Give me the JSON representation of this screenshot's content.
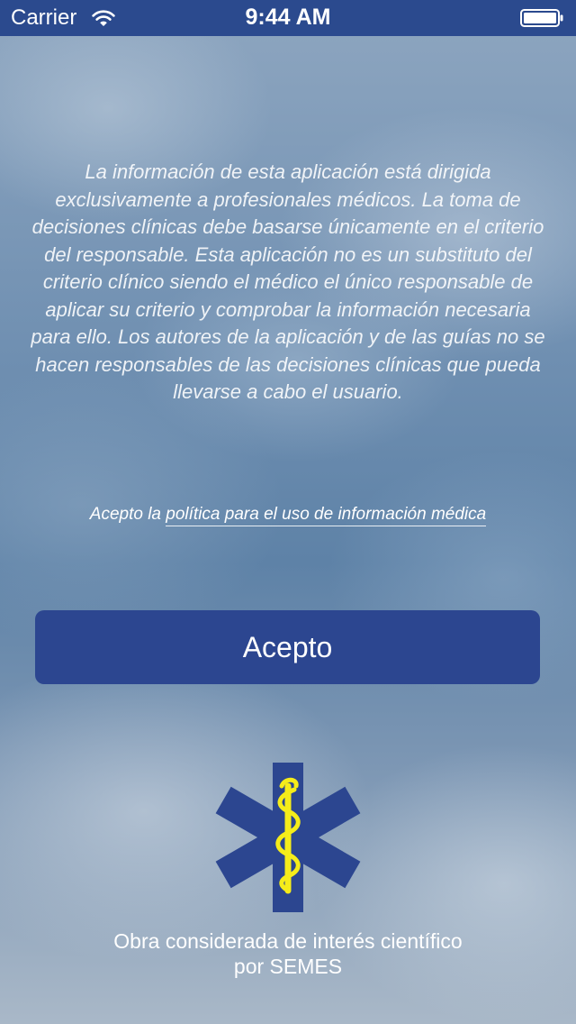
{
  "status_bar": {
    "carrier": "Carrier",
    "time": "9:44 AM",
    "wifi_icon": "wifi-icon",
    "battery_icon": "battery-icon"
  },
  "disclaimer": {
    "text": "La información de esta aplicación está dirigida exclusivamente a profesionales médicos. La toma de decisiones clínicas debe basarse únicamente en el criterio del responsable. Esta aplicación no es un substituto del criterio clínico siendo el médico el único responsable de aplicar su criterio y comprobar la información necesaria para ello. Los autores de la aplicación y de las guías no se hacen responsables de las decisiones clínicas que pueda llevarse a cabo el usuario."
  },
  "policy": {
    "prefix": "Acepto la ",
    "link_text": "política para el uso de información médica"
  },
  "accept_button": {
    "label": "Acepto"
  },
  "logo": {
    "icon": "star-of-life-icon",
    "colors": {
      "star": "#2c4690",
      "staff": "#f5ec1a"
    }
  },
  "footer": {
    "line1": "Obra considerada de interés científico",
    "line2": "por SEMES"
  },
  "colors": {
    "status_bar": "#2b4a8e",
    "button": "#2c4690",
    "text": "#ffffff"
  }
}
